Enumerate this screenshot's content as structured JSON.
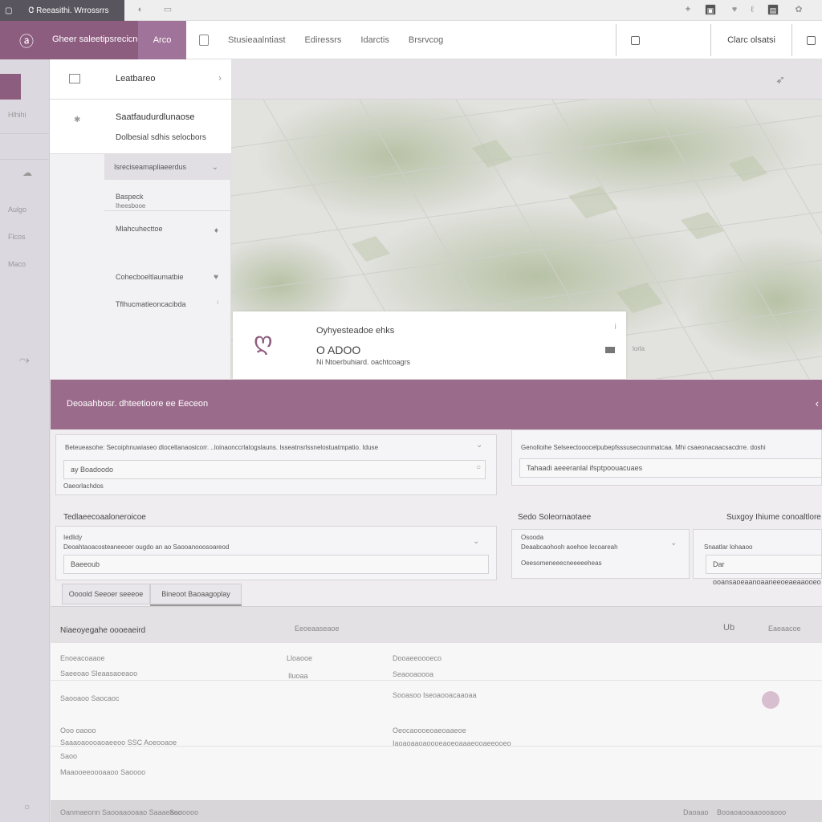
{
  "chrome": {
    "tab_icon": "window-icon",
    "tab_title": "Ꮳ Reeasithi. Wrrossrrs",
    "icons": [
      "back-icon",
      "page-icon",
      "extension-icon",
      "app-icon",
      "shield-icon",
      "pen-icon",
      "app-icon",
      "gear-icon"
    ]
  },
  "header": {
    "brand_name": "Gheer saleetipsrecicnen",
    "module_label": "Arco",
    "nav": [
      "Stusieaalntiast",
      "Ediressrs",
      "Idarctis",
      "Brsrvcog"
    ],
    "user": "Clarc olsatsi"
  },
  "rail": {
    "items": [
      "Hlhihi",
      "Aulgo",
      "Flcos",
      "Maco"
    ]
  },
  "panel": {
    "head_title": "Leatbareo",
    "block_title": "Saatfaudurdlunaose",
    "block_sub": "Dolbesial sdhis selocbors",
    "options": [
      {
        "label": "Isreciseamapliaeerdus",
        "sub": ""
      },
      {
        "label": "Baspeck",
        "sub": "Iheesbooe"
      },
      {
        "label": "Mlahcuhecttoe",
        "sub": ""
      },
      {
        "label": "Cohecboeltlaumatbie",
        "sub": ""
      },
      {
        "label": "Tflhucmatieoncacibda",
        "sub": ""
      }
    ]
  },
  "card": {
    "title": "Oyhyesteadoe ehks",
    "value": "O ADOO",
    "note": "Ni Ntoerbuhiard. oachtcoagrs",
    "map_label": "lorla"
  },
  "bar": {
    "title": "Deoaahbosr. dhteetioore ee Eeceon"
  },
  "form": {
    "left_long": "Beteueasohe: Secoiphnuwiaseo dtoceltanaosicorr. ..loinaonccrlatogslauns. Isseatnsrlssnelostuatmpatio. Iduse",
    "left_field": "ay Boadoodo",
    "left_hint": "Oaeorlachdos",
    "right_long": "Genolloihe Selseectooocelpubepfsssusecounmatcaa. Mhi csaeonacaacsacdrre. doshi",
    "right_field": "Tahaadi aeeeranlal ifsptpoouacuaes",
    "sec2_title": "Tedlaeecoaaloneroicoe",
    "sec2_lbl": "Iedlidy",
    "sec2_field": "Deoahtaoacosteaneeoer ougdo an ao Saooanooosoareod",
    "sec2_field2": "Baeeoub",
    "sec3_title": "Sedo Soleornaotaee",
    "sec3_lbl": "Osooda",
    "sec3_field": "Deaabcaohooh aoehoe lecoareah",
    "sec3_field2": "Oeesomeneeecneeeeeheas",
    "sec4_title": "Suxgoy Ihiume conoaltlore",
    "sec4_field": "Snaatlar lohaaoo",
    "sec4_field2": "Dar ooansaoeaanoaaneeoeaeaaooeo",
    "btn1": "Oooold Seeoer seeeoe",
    "btn2": "Bineoot Baoaagoplay"
  },
  "table": {
    "title": "Niaeoyegahe oooeaeird",
    "col2": "Eeoeaaseaoe",
    "col_r1": "Ub",
    "col_r2": "Eaeaacoe",
    "rows": [
      {
        "a": "Enoeacoaaoe",
        "b": "Lloaooe",
        "c": "Dooaeeoooeco"
      },
      {
        "a": "Saeeoao Sleaasaoeaoo",
        "b": "Iluoaa",
        "c": "Seaooaoooa"
      },
      {
        "a": "Saooaoo Saocaoc",
        "b": "",
        "c": "Sooasoo Iseoaooacaaoaa"
      },
      {
        "a": "Ooo oaooo",
        "b": "",
        "c": "Oeocaoooeoaeoaaeoe"
      },
      {
        "a": "Saaaoaoooaoaeeoo SSC Aoeooaoe",
        "b": "",
        "c": "Iaoaoaaoaoooeaoeoaaaeooaeeooeo"
      },
      {
        "a": "Saoo",
        "b": "",
        "c": ""
      },
      {
        "a": "Maaooeeoooaaoo Saoooo",
        "b": "",
        "c": ""
      }
    ]
  },
  "footer": {
    "left": "Oanmaeonn Saooaaooaao Saaaeaoo",
    "mid": "Saooooo",
    "right1": "Daoaao",
    "right2": "Booaoaooaaoooaooo"
  },
  "colors": {
    "accent": "#8d5d80",
    "accent_bar": "#9b6b8c",
    "map_green": "#a9b792"
  }
}
